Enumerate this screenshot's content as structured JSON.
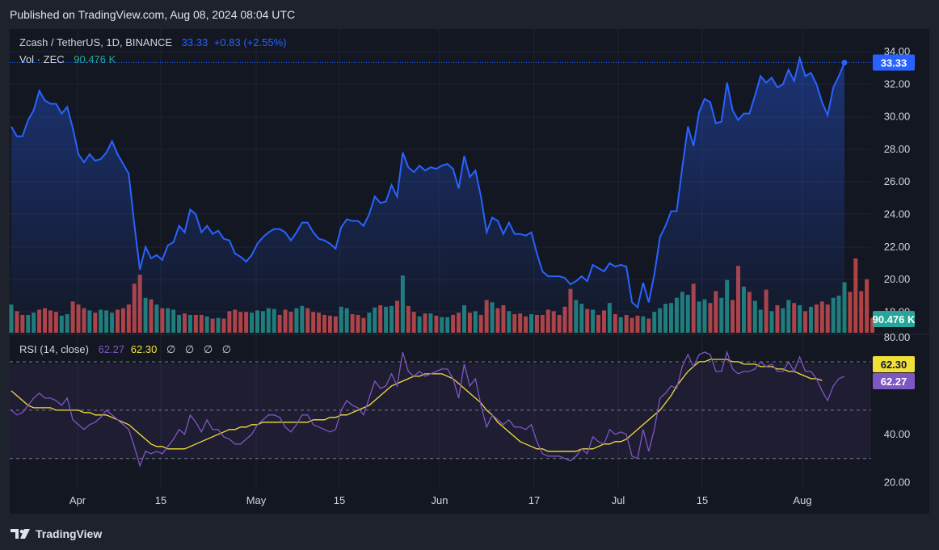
{
  "header": {
    "published": "Published on TradingView.com, Aug 08, 2024 08:04 UTC"
  },
  "legend": {
    "symbol": "Zcash / TetherUS, 1D, BINANCE",
    "last": "33.33",
    "change": "+0.83 (+2.55%)",
    "vol_label": "Vol · ZEC",
    "vol_value": "90.476 K",
    "rsi_label": "RSI (14, close)",
    "rsi_value": "62.27",
    "rsi_ma_value": "62.30",
    "rsi_extra": "∅ ∅ ∅ ∅"
  },
  "colors": {
    "price_line": "#2962ff",
    "vol_up": "#26a69a",
    "vol_down": "#ef5350",
    "rsi_line": "#7e57c2",
    "rsi_ma": "#f2e03a"
  },
  "footer": {
    "brand": "TradingView"
  },
  "chart_data": [
    {
      "type": "line",
      "title": "Zcash / TetherUS, 1D, BINANCE",
      "ylim": [
        18,
        34
      ],
      "y_ticks": [
        "34.00",
        "32.00",
        "30.00",
        "28.00",
        "26.00",
        "24.00",
        "22.00",
        "20.00",
        "18.00"
      ],
      "x_ticks": [
        "Apr",
        "15",
        "May",
        "15",
        "Jun",
        "17",
        "Jul",
        "15",
        "Aug"
      ],
      "last_label": "33.33",
      "values": [
        29.4,
        28.8,
        28.8,
        29.8,
        30.4,
        31.6,
        31.0,
        30.8,
        30.8,
        30.2,
        30.6,
        29.3,
        27.7,
        27.2,
        27.7,
        27.3,
        27.4,
        27.8,
        28.5,
        27.7,
        27.1,
        26.5,
        23.4,
        20.6,
        22.0,
        21.3,
        21.5,
        21.2,
        22.1,
        22.3,
        23.3,
        22.9,
        24.3,
        24.0,
        22.9,
        23.3,
        22.8,
        23.0,
        22.5,
        22.4,
        21.6,
        21.4,
        21.1,
        21.5,
        22.2,
        22.6,
        22.9,
        23.1,
        23.1,
        22.9,
        22.4,
        22.9,
        23.5,
        23.5,
        22.9,
        22.5,
        22.4,
        22.2,
        21.9,
        23.2,
        23.7,
        23.6,
        23.6,
        23.3,
        24.0,
        25.1,
        24.7,
        24.8,
        25.8,
        25.1,
        27.8,
        26.9,
        26.6,
        27.0,
        26.7,
        26.9,
        26.8,
        27.0,
        27.1,
        26.8,
        25.6,
        27.6,
        26.3,
        26.7,
        25.1,
        22.9,
        23.8,
        23.6,
        22.8,
        23.5,
        22.8,
        22.8,
        22.7,
        22.9,
        21.6,
        20.5,
        20.2,
        20.2,
        20.2,
        20.1,
        19.7,
        19.9,
        20.2,
        19.9,
        20.9,
        20.7,
        20.5,
        21.0,
        20.8,
        20.9,
        20.8,
        18.6,
        18.3,
        19.8,
        18.6,
        20.3,
        22.6,
        23.3,
        24.2,
        24.2,
        26.9,
        29.4,
        28.2,
        30.3,
        31.1,
        30.9,
        29.6,
        29.7,
        32.1,
        30.4,
        29.8,
        30.2,
        30.2,
        31.3,
        32.5,
        32.1,
        32.4,
        31.8,
        32.0,
        32.9,
        32.2,
        33.6,
        32.5,
        32.7,
        32.0,
        30.9,
        30.1,
        31.8,
        32.5,
        33.33
      ]
    },
    {
      "type": "bar",
      "title": "Vol · ZEC",
      "last_label": "90.476 K",
      "values": [
        0.38,
        0.29,
        0.24,
        0.24,
        0.27,
        0.31,
        0.33,
        0.3,
        0.28,
        0.23,
        0.25,
        0.42,
        0.38,
        0.33,
        0.3,
        0.27,
        0.31,
        0.3,
        0.27,
        0.31,
        0.33,
        0.38,
        0.66,
        0.78,
        0.47,
        0.45,
        0.38,
        0.33,
        0.33,
        0.31,
        0.24,
        0.26,
        0.24,
        0.24,
        0.24,
        0.22,
        0.19,
        0.2,
        0.19,
        0.29,
        0.31,
        0.28,
        0.28,
        0.27,
        0.3,
        0.29,
        0.33,
        0.32,
        0.24,
        0.31,
        0.28,
        0.33,
        0.36,
        0.33,
        0.28,
        0.27,
        0.24,
        0.23,
        0.22,
        0.35,
        0.33,
        0.25,
        0.24,
        0.2,
        0.27,
        0.34,
        0.37,
        0.35,
        0.36,
        0.43,
        0.77,
        0.36,
        0.28,
        0.22,
        0.26,
        0.26,
        0.23,
        0.21,
        0.21,
        0.24,
        0.27,
        0.37,
        0.27,
        0.29,
        0.24,
        0.44,
        0.41,
        0.33,
        0.37,
        0.29,
        0.25,
        0.26,
        0.22,
        0.25,
        0.24,
        0.24,
        0.31,
        0.29,
        0.24,
        0.35,
        0.59,
        0.44,
        0.39,
        0.32,
        0.31,
        0.24,
        0.3,
        0.4,
        0.25,
        0.21,
        0.24,
        0.2,
        0.23,
        0.22,
        0.19,
        0.28,
        0.33,
        0.39,
        0.4,
        0.47,
        0.55,
        0.51,
        0.66,
        0.42,
        0.45,
        0.4,
        0.56,
        0.47,
        0.71,
        0.44,
        0.9,
        0.62,
        0.55,
        0.43,
        0.31,
        0.58,
        0.29,
        0.37,
        0.33,
        0.44,
        0.4,
        0.37,
        0.29,
        0.35,
        0.38,
        0.42,
        0.38,
        0.47,
        0.5,
        0.68,
        0.55,
        1.0,
        0.56,
        0.72,
        0.2
      ],
      "up": [
        1,
        0,
        0,
        1,
        1,
        0,
        0,
        0,
        0,
        1,
        1,
        0,
        0,
        0,
        1,
        0,
        1,
        1,
        1,
        0,
        0,
        0,
        0,
        0,
        1,
        0,
        1,
        0,
        1,
        1,
        1,
        0,
        1,
        0,
        0,
        1,
        0,
        1,
        0,
        0,
        0,
        0,
        0,
        1,
        1,
        1,
        1,
        1,
        0,
        0,
        0,
        1,
        1,
        0,
        0,
        0,
        0,
        0,
        0,
        1,
        1,
        0,
        0,
        0,
        1,
        1,
        0,
        1,
        1,
        0,
        1,
        0,
        0,
        1,
        0,
        1,
        0,
        1,
        1,
        0,
        0,
        1,
        0,
        1,
        0,
        0,
        1,
        0,
        0,
        1,
        0,
        0,
        0,
        1,
        0,
        0,
        0,
        0,
        0,
        0,
        0,
        1,
        1,
        0,
        1,
        0,
        0,
        1,
        0,
        1,
        0,
        0,
        0,
        1,
        0,
        1,
        1,
        1,
        1,
        1,
        1,
        1,
        0,
        1,
        1,
        0,
        0,
        1,
        1,
        0,
        0,
        1,
        0,
        1,
        1,
        0,
        1,
        0,
        1,
        1,
        0,
        1,
        0,
        1,
        0,
        0,
        0,
        1,
        1,
        1
      ]
    },
    {
      "type": "line",
      "title": "RSI (14, close)",
      "ylim": [
        20,
        80
      ],
      "y_ticks": [
        "80.00",
        "40.00",
        "20.00"
      ],
      "bands": [
        30,
        50,
        70
      ],
      "series": [
        {
          "name": "RSI",
          "values": [
            50,
            48,
            49,
            52,
            55,
            57,
            55,
            55,
            54,
            52,
            55,
            46,
            44,
            42,
            44,
            45,
            47,
            50,
            48,
            46,
            44,
            42,
            35,
            27,
            33,
            32,
            33,
            32,
            35,
            38,
            42,
            40,
            48,
            45,
            41,
            46,
            42,
            42,
            39,
            38,
            36,
            36,
            38,
            40,
            44,
            46,
            48,
            48,
            47,
            43,
            41,
            44,
            48,
            48,
            44,
            43,
            42,
            41,
            42,
            50,
            54,
            52,
            51,
            48,
            55,
            62,
            59,
            60,
            65,
            60,
            74,
            66,
            64,
            66,
            64,
            65,
            66,
            67,
            67,
            63,
            55,
            69,
            60,
            63,
            52,
            43,
            48,
            46,
            44,
            46,
            43,
            43,
            42,
            44,
            37,
            32,
            31,
            31,
            31,
            30,
            29,
            31,
            34,
            32,
            39,
            37,
            36,
            42,
            40,
            41,
            40,
            31,
            30,
            42,
            33,
            42,
            55,
            57,
            60,
            59,
            68,
            73,
            68,
            73,
            74,
            73,
            66,
            66,
            74,
            67,
            65,
            66,
            66,
            67,
            70,
            68,
            69,
            66,
            66,
            70,
            66,
            72,
            66,
            66,
            63,
            58,
            54,
            60,
            63,
            64
          ]
        },
        {
          "name": "RSI-based MA",
          "values": [
            58,
            56,
            54,
            52,
            51,
            51,
            51,
            51,
            50,
            50,
            50,
            50,
            50,
            49,
            49,
            48,
            48,
            48,
            47,
            46,
            45,
            44,
            42,
            40,
            38,
            36,
            35,
            35,
            34,
            34,
            34,
            34,
            35,
            36,
            37,
            38,
            39,
            40,
            41,
            42,
            42,
            43,
            43,
            44,
            44,
            45,
            45,
            45,
            45,
            45,
            45,
            45,
            45,
            45,
            46,
            46,
            46,
            47,
            47,
            48,
            48,
            49,
            50,
            51,
            52,
            54,
            56,
            58,
            60,
            61,
            62,
            63,
            64,
            64,
            65,
            65,
            65,
            65,
            64,
            63,
            61,
            59,
            57,
            55,
            53,
            50,
            48,
            45,
            43,
            41,
            39,
            37,
            36,
            35,
            34,
            34,
            33,
            33,
            33,
            33,
            33,
            33,
            34,
            34,
            34,
            35,
            36,
            36,
            37,
            37,
            38,
            40,
            42,
            44,
            46,
            48,
            50,
            53,
            56,
            60,
            63,
            66,
            68,
            70,
            70,
            71,
            71,
            71,
            71,
            70,
            70,
            69,
            69,
            69,
            68,
            68,
            68,
            67,
            67,
            66,
            66,
            65,
            64,
            63,
            63,
            62.3
          ]
        }
      ]
    }
  ]
}
